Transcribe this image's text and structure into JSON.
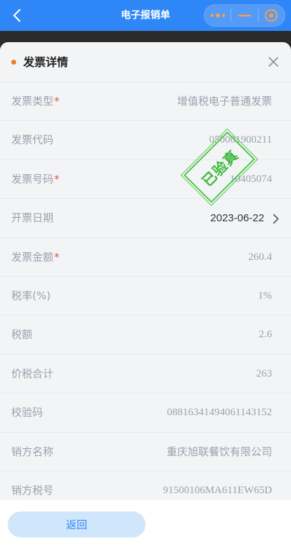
{
  "header": {
    "title": "电子报销单",
    "back_icon": "chevron-left-icon",
    "capsule": {
      "more_icon": "more-dots-icon",
      "minimize_icon": "minimize-icon",
      "close_icon": "target-close-icon"
    },
    "background": "#2f86f6"
  },
  "sheet": {
    "title": "发票详情",
    "close_icon": "close-x-icon",
    "accent": "#f07a2a",
    "rows": [
      {
        "label": "发票类型",
        "required": "*",
        "value": "增值税电子普通发票"
      },
      {
        "label": "发票代码",
        "required": "",
        "value": "050001900211"
      },
      {
        "label": "发票号码",
        "required": "*",
        "value": "10405074"
      },
      {
        "label": "开票日期",
        "required": "",
        "value": "2023-06-22"
      },
      {
        "label": "发票金额",
        "required": "*",
        "value": "260.4"
      },
      {
        "label": "税率(%)",
        "required": "",
        "value": "1%"
      },
      {
        "label": "税额",
        "required": "",
        "value": "2.6"
      },
      {
        "label": "价税合计",
        "required": "",
        "value": "263"
      },
      {
        "label": "校验码",
        "required": "",
        "value": "08816341494061143152"
      },
      {
        "label": "销方名称",
        "required": "",
        "value": "重庆旭联餐饮有限公司"
      },
      {
        "label": "销方税号",
        "required": "",
        "value": "91500106MA611EW65D"
      }
    ]
  },
  "stamp": {
    "text": "已验真",
    "color": "#3cb93c"
  },
  "footer": {
    "return_label": "返回"
  }
}
